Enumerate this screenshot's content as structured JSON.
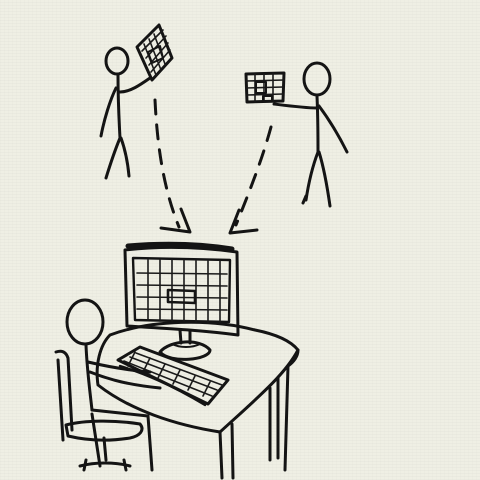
{
  "colors": {
    "paper": "#efefe4",
    "ink": "#141414"
  },
  "icons": [
    "person-left-icon",
    "paper-grid-left-icon",
    "person-right-icon",
    "paper-grid-right-icon",
    "arrow-left-icon",
    "arrow-right-icon",
    "monitor-icon",
    "keyboard-icon",
    "desk-icon",
    "seated-person-icon",
    "chair-icon"
  ]
}
